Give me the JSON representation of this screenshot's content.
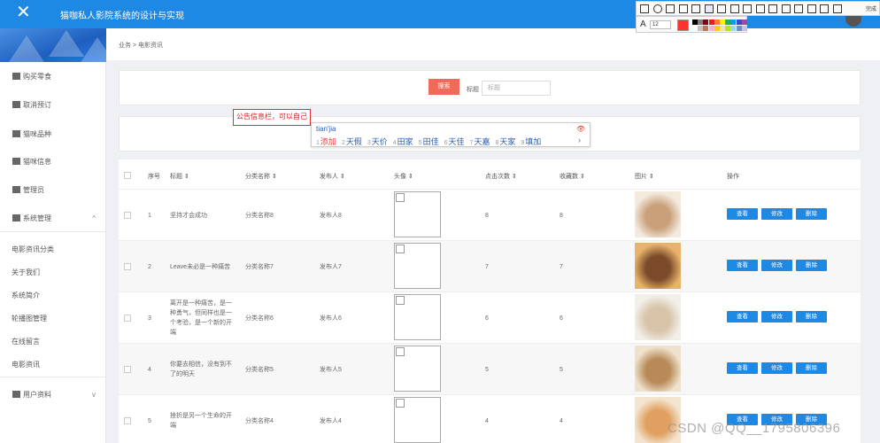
{
  "app": {
    "title": "猫咖私人影院系统的设计与实现"
  },
  "sidebar": {
    "items": [
      {
        "label": "购买零食",
        "icon": "clipboard-icon"
      },
      {
        "label": "取消预订",
        "icon": "bar-chart-icon"
      },
      {
        "label": "猫咪品种",
        "icon": "grid-icon"
      },
      {
        "label": "猫咪信息",
        "icon": "grid-icon"
      },
      {
        "label": "管理员",
        "icon": "monitor-icon"
      },
      {
        "label": "系统管理",
        "icon": "checkbox-icon",
        "chevron": "^"
      }
    ],
    "sub_items": [
      "电影资讯分类",
      "关于我们",
      "系统简介",
      "轮播图管理",
      "在线留言",
      "电影资讯"
    ],
    "user_section": {
      "label": "用户资料",
      "icon": "id-card-icon",
      "chevron": "v"
    }
  },
  "breadcrumb": "业务 > 电影资讯",
  "search": {
    "button": "搜索",
    "label": "标题",
    "placeholder": "标题"
  },
  "notice_input": {
    "value": "公告信息栏，可以自己"
  },
  "ime": {
    "pinyin": "tian'jia",
    "candidates": [
      {
        "n": "1",
        "t": "添加"
      },
      {
        "n": "2",
        "t": "天假"
      },
      {
        "n": "3",
        "t": "天价"
      },
      {
        "n": "4",
        "t": "田家"
      },
      {
        "n": "5",
        "t": "田佳"
      },
      {
        "n": "6",
        "t": "天佳"
      },
      {
        "n": "7",
        "t": "天嘉"
      },
      {
        "n": "8",
        "t": "天家"
      },
      {
        "n": "9",
        "t": "填加"
      }
    ],
    "more": "›"
  },
  "table": {
    "headers": [
      "序号",
      "标题 ⇕",
      "分类名称 ⇕",
      "发布人 ⇕",
      "头像 ⇕",
      "点击次数 ⇕",
      "收藏数 ⇕",
      "图片 ⇕",
      "操作"
    ],
    "rows": [
      {
        "id": "1",
        "title": [
          "坚持才会成功"
        ],
        "category": "分类名称8",
        "publisher": "发布人8",
        "clicks": "8",
        "favorites": "8"
      },
      {
        "id": "2",
        "title": [
          "Leave未必是一种痛苦"
        ],
        "category": "分类名称7",
        "publisher": "发布人7",
        "clicks": "7",
        "favorites": "7"
      },
      {
        "id": "3",
        "title": [
          "离开是一种痛苦，是一",
          "种勇气，但同样也是一",
          "个考验，是一个新的开",
          "端"
        ],
        "category": "分类名称6",
        "publisher": "发布人6",
        "clicks": "6",
        "favorites": "6"
      },
      {
        "id": "4",
        "title": [
          "你要去相信，没有到不",
          "了的明天"
        ],
        "category": "分类名称5",
        "publisher": "发布人5",
        "clicks": "5",
        "favorites": "5"
      },
      {
        "id": "5",
        "title": [
          "挫折是另一个生命的开",
          "端"
        ],
        "category": "分类名称4",
        "publisher": "发布人4",
        "clicks": "4",
        "favorites": "4"
      }
    ],
    "actions": {
      "view": "查看",
      "edit": "修改",
      "delete": "删除"
    }
  },
  "snip_toolbar": {
    "font_size": "12",
    "done": "完成"
  },
  "colors": {
    "primary": "#1e88e5",
    "danger_btn": "#f06a5a",
    "current_pen": "#ff3030"
  },
  "watermark": "CSDN @QQ__1795806396"
}
